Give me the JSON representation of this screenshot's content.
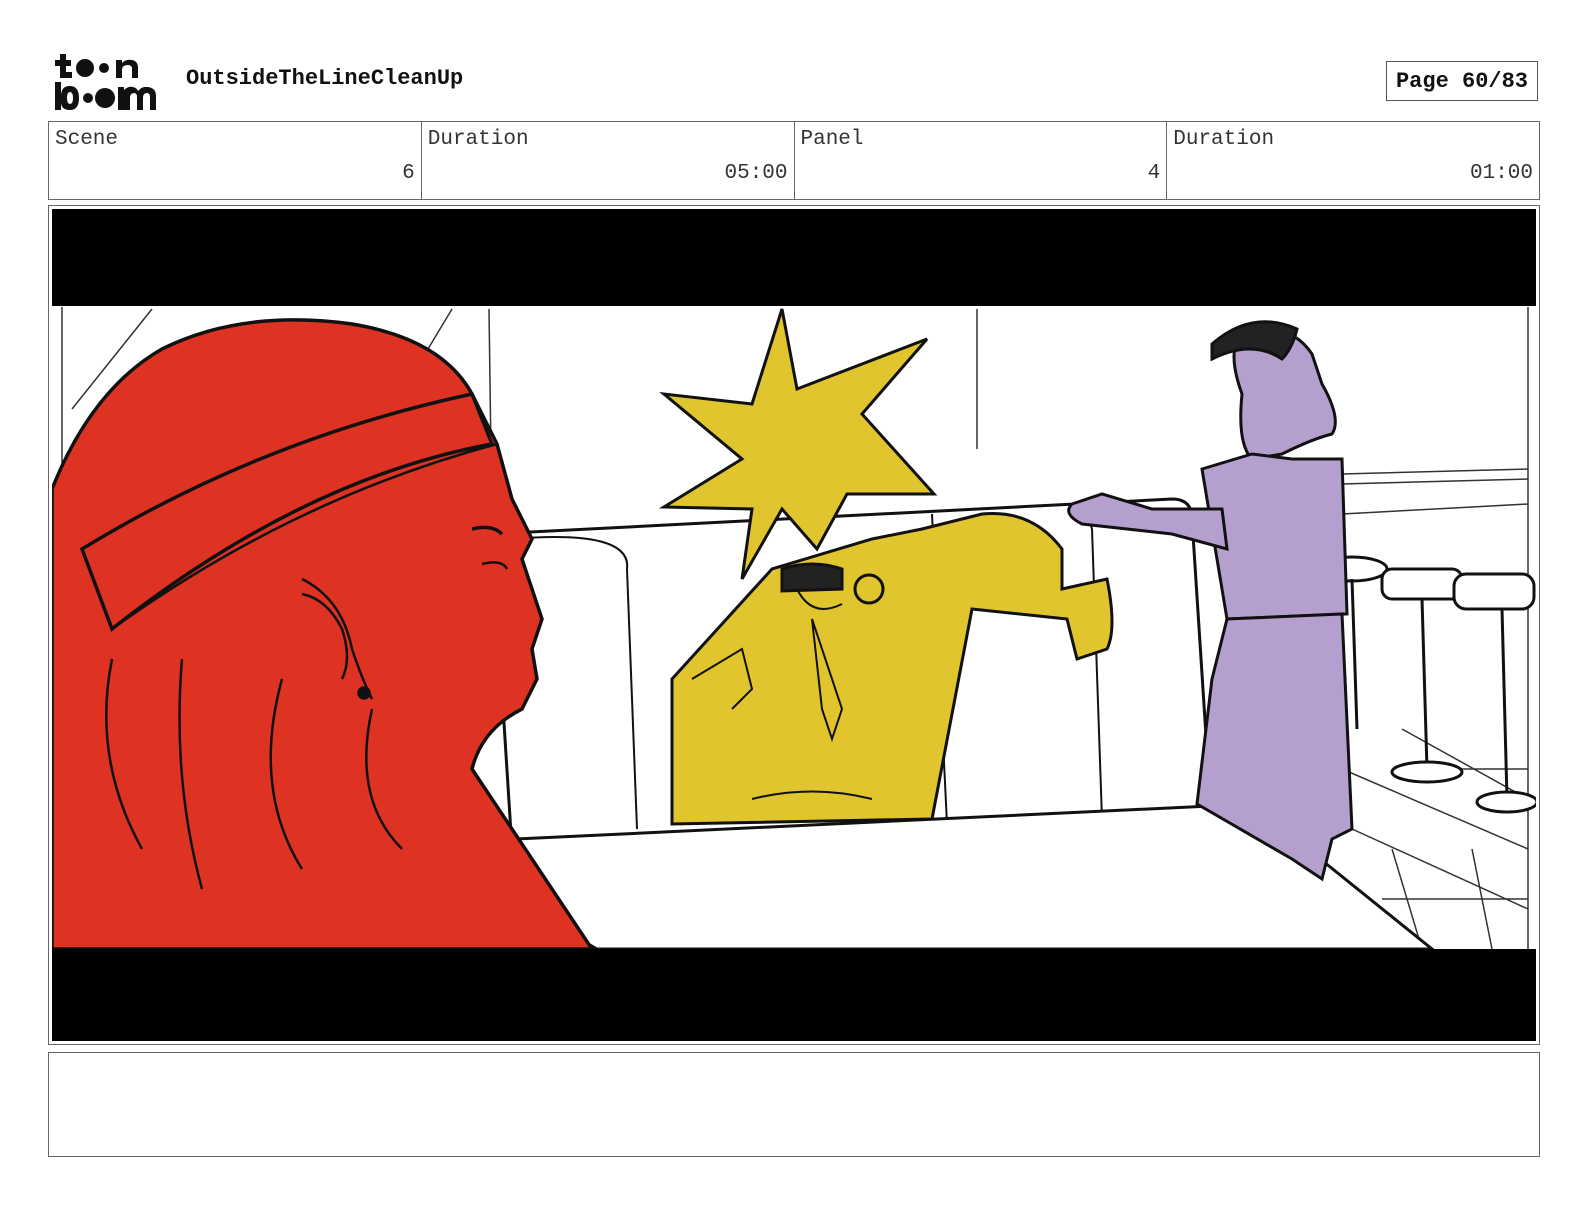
{
  "header": {
    "logo_text": "toonboom",
    "project_title": "OutsideTheLineCleanUp",
    "page_label": "Page 60/83"
  },
  "info": {
    "scene_label": "Scene",
    "scene_value": "6",
    "scene_duration_label": "Duration",
    "scene_duration_value": "05:00",
    "panel_label": "Panel",
    "panel_value": "4",
    "panel_duration_label": "Duration",
    "panel_duration_value": "01:00"
  },
  "panel": {
    "colors": {
      "letterbox": "#000000",
      "red_character": "#de3222",
      "yellow_character": "#e0c52e",
      "purple_character": "#b49fcf",
      "line": "#111111"
    }
  },
  "notes": {
    "text": ""
  }
}
